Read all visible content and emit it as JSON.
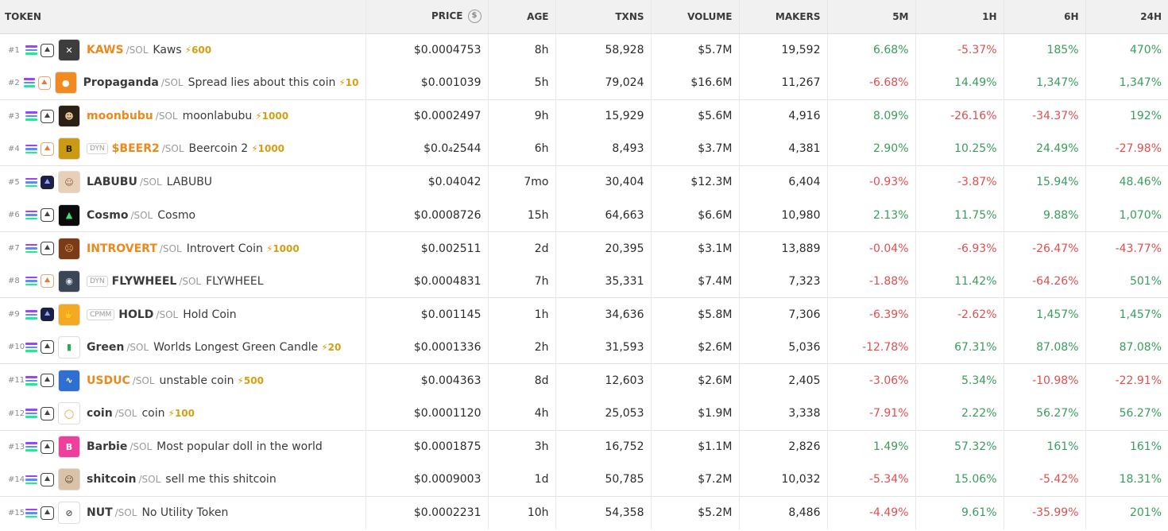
{
  "headers": {
    "token": "TOKEN",
    "price": "PRICE",
    "price_icon": "$",
    "age": "AGE",
    "txns": "TXNS",
    "volume": "VOLUME",
    "makers": "MAKERS",
    "m5": "5M",
    "h1": "1H",
    "h6": "6H",
    "h24": "24H"
  },
  "colors": {
    "positive": "#3a9d5d",
    "negative": "#e14f4f",
    "boosted_symbol": "#ea8a1c",
    "boost": "#d4a013"
  },
  "rows": [
    {
      "rank": "#1",
      "badge": "",
      "symbol": "KAWS",
      "boosted": true,
      "quote": "/SOL",
      "name": "Kaws",
      "boost": "⚡600",
      "price": "$0.0004753",
      "age": "8h",
      "txns": "58,928",
      "volume": "$5.7M",
      "makers": "19,592",
      "m5": "6.68%",
      "h1": "-5.37%",
      "h6": "185%",
      "h24": "470%",
      "logo_icon": "kaws-logo"
    },
    {
      "rank": "#2",
      "badge": "",
      "symbol": "Propaganda",
      "boosted": false,
      "quote": "/SOL",
      "name": "Spread lies about this coin",
      "boost": "⚡10",
      "price": "$0.001039",
      "age": "5h",
      "txns": "79,024",
      "volume": "$16.6M",
      "makers": "11,267",
      "m5": "-6.68%",
      "h1": "14.49%",
      "h6": "1,347%",
      "h24": "1,347%",
      "logo_icon": "propaganda-logo"
    },
    {
      "rank": "#3",
      "badge": "",
      "symbol": "moonbubu",
      "boosted": true,
      "quote": "/SOL",
      "name": "moonlabubu",
      "boost": "⚡1000",
      "price": "$0.0002497",
      "age": "9h",
      "txns": "15,929",
      "volume": "$5.6M",
      "makers": "4,916",
      "m5": "8.09%",
      "h1": "-26.16%",
      "h6": "-34.37%",
      "h24": "192%",
      "logo_icon": "moonbubu-logo"
    },
    {
      "rank": "#4",
      "badge": "DYN",
      "symbol": "$BEER2",
      "boosted": true,
      "quote": "/SOL",
      "name": "Beercoin 2",
      "boost": "⚡1000",
      "price": "$0.0₄2544",
      "age": "6h",
      "txns": "8,493",
      "volume": "$3.7M",
      "makers": "4,381",
      "m5": "2.90%",
      "h1": "10.25%",
      "h6": "24.49%",
      "h24": "-27.98%",
      "logo_icon": "beer-logo"
    },
    {
      "rank": "#5",
      "badge": "",
      "symbol": "LABUBU",
      "boosted": false,
      "quote": "/SOL",
      "name": "LABUBU",
      "boost": "",
      "price": "$0.04042",
      "age": "7mo",
      "txns": "30,404",
      "volume": "$12.3M",
      "makers": "6,404",
      "m5": "-0.93%",
      "h1": "-3.87%",
      "h6": "15.94%",
      "h24": "48.46%",
      "logo_icon": "labubu-logo"
    },
    {
      "rank": "#6",
      "badge": "",
      "symbol": "Cosmo",
      "boosted": false,
      "quote": "/SOL",
      "name": "Cosmo",
      "boost": "",
      "price": "$0.0008726",
      "age": "15h",
      "txns": "64,663",
      "volume": "$6.6M",
      "makers": "10,980",
      "m5": "2.13%",
      "h1": "11.75%",
      "h6": "9.88%",
      "h24": "1,070%",
      "logo_icon": "cosmo-logo"
    },
    {
      "rank": "#7",
      "badge": "",
      "symbol": "INTROVERT",
      "boosted": true,
      "quote": "/SOL",
      "name": "Introvert Coin",
      "boost": "⚡1000",
      "price": "$0.002511",
      "age": "2d",
      "txns": "20,395",
      "volume": "$3.1M",
      "makers": "13,889",
      "m5": "-0.04%",
      "h1": "-6.93%",
      "h6": "-26.47%",
      "h24": "-43.77%",
      "logo_icon": "introvert-logo"
    },
    {
      "rank": "#8",
      "badge": "DYN",
      "symbol": "FLYWHEEL",
      "boosted": false,
      "quote": "/SOL",
      "name": "FLYWHEEL",
      "boost": "",
      "price": "$0.0004831",
      "age": "7h",
      "txns": "35,331",
      "volume": "$7.4M",
      "makers": "7,323",
      "m5": "-1.88%",
      "h1": "11.42%",
      "h6": "-64.26%",
      "h24": "501%",
      "logo_icon": "flywheel-logo"
    },
    {
      "rank": "#9",
      "badge": "CPMM",
      "symbol": "HOLD",
      "boosted": false,
      "quote": "/SOL",
      "name": "Hold Coin",
      "boost": "",
      "price": "$0.001145",
      "age": "1h",
      "txns": "34,636",
      "volume": "$5.8M",
      "makers": "7,306",
      "m5": "-6.39%",
      "h1": "-2.62%",
      "h6": "1,457%",
      "h24": "1,457%",
      "logo_icon": "hold-logo"
    },
    {
      "rank": "#10",
      "badge": "",
      "symbol": "Green",
      "boosted": false,
      "quote": "/SOL",
      "name": "Worlds Longest Green Candle",
      "boost": "⚡20",
      "price": "$0.0001336",
      "age": "2h",
      "txns": "31,593",
      "volume": "$2.6M",
      "makers": "5,036",
      "m5": "-12.78%",
      "h1": "67.31%",
      "h6": "87.08%",
      "h24": "87.08%",
      "logo_icon": "green-candle-logo"
    },
    {
      "rank": "#11",
      "badge": "",
      "symbol": "USDUC",
      "boosted": true,
      "quote": "/SOL",
      "name": "unstable coin",
      "boost": "⚡500",
      "price": "$0.004363",
      "age": "8d",
      "txns": "12,603",
      "volume": "$2.6M",
      "makers": "2,405",
      "m5": "-3.06%",
      "h1": "5.34%",
      "h6": "-10.98%",
      "h24": "-22.91%",
      "logo_icon": "usduc-logo"
    },
    {
      "rank": "#12",
      "badge": "",
      "symbol": "coin",
      "boosted": false,
      "quote": "/SOL",
      "name": "coin",
      "boost": "⚡100",
      "price": "$0.0001120",
      "age": "4h",
      "txns": "25,053",
      "volume": "$1.9M",
      "makers": "3,338",
      "m5": "-7.91%",
      "h1": "2.22%",
      "h6": "56.27%",
      "h24": "56.27%",
      "logo_icon": "coin-logo"
    },
    {
      "rank": "#13",
      "badge": "",
      "symbol": "Barbie",
      "boosted": false,
      "quote": "/SOL",
      "name": "Most popular doll in the world",
      "boost": "",
      "price": "$0.0001875",
      "age": "3h",
      "txns": "16,752",
      "volume": "$1.1M",
      "makers": "2,826",
      "m5": "1.49%",
      "h1": "57.32%",
      "h6": "161%",
      "h24": "161%",
      "logo_icon": "barbie-logo"
    },
    {
      "rank": "#14",
      "badge": "",
      "symbol": "shitcoin",
      "boosted": false,
      "quote": "/SOL",
      "name": "sell me this shitcoin",
      "boost": "",
      "price": "$0.0009003",
      "age": "1d",
      "txns": "50,785",
      "volume": "$7.2M",
      "makers": "10,032",
      "m5": "-5.34%",
      "h1": "15.06%",
      "h6": "-5.42%",
      "h24": "18.31%",
      "logo_icon": "shitcoin-logo"
    },
    {
      "rank": "#15",
      "badge": "",
      "symbol": "NUT",
      "boosted": false,
      "quote": "/SOL",
      "name": "No Utility Token",
      "boost": "",
      "price": "$0.0002231",
      "age": "10h",
      "txns": "54,358",
      "volume": "$5.2M",
      "makers": "8,486",
      "m5": "-4.49%",
      "h1": "9.61%",
      "h6": "-35.99%",
      "h24": "201%",
      "logo_icon": "nut-logo"
    }
  ]
}
